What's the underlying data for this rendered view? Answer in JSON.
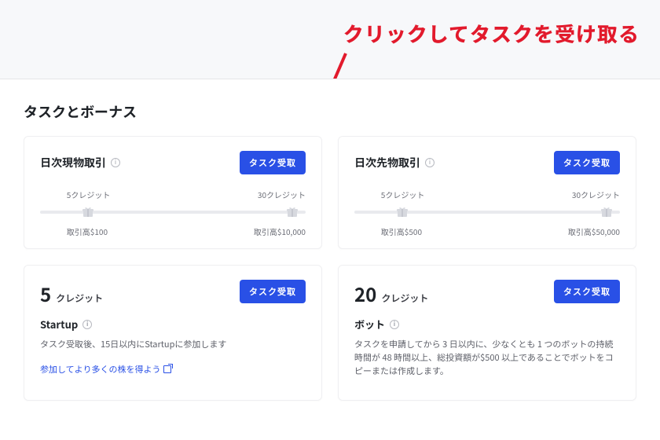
{
  "annotation": {
    "callout": "クリックしてタスクを受け取る"
  },
  "page": {
    "title": "タスクとボーナス"
  },
  "buttons": {
    "receive": "タスク受取"
  },
  "cards": {
    "spot": {
      "title": "日次現物取引",
      "milestone1_label": "5クレジット",
      "milestone2_label": "30クレジット",
      "milestone1_sub": "取引高$100",
      "milestone2_sub": "取引高$10,000"
    },
    "futures": {
      "title": "日次先物取引",
      "milestone1_label": "5クレジット",
      "milestone2_label": "30クレジット",
      "milestone1_sub": "取引高$500",
      "milestone2_sub": "取引高$50,000"
    },
    "startup": {
      "credits": "5",
      "credits_label": "クレジット",
      "subtitle": "Startup",
      "desc": "タスク受取後、15日以内にStartupに参加します",
      "link": "参加してより多くの株を得よう"
    },
    "bot": {
      "credits": "20",
      "credits_label": "クレジット",
      "subtitle": "ボット",
      "desc": "タスクを申請してから 3 日以内に、少なくとも 1 つのボットの持続時間が 48 時間以上、総投資額が$500 以上であることでボットをコピーまたは作成します。"
    }
  }
}
